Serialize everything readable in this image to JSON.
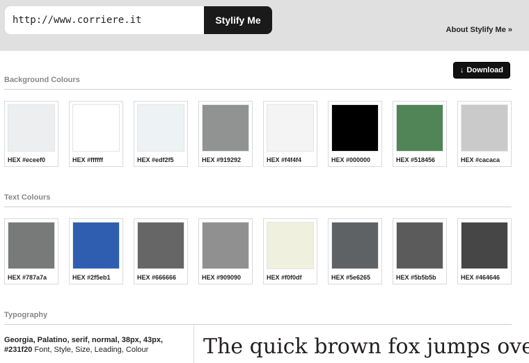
{
  "header": {
    "url_value": "http://www.corriere.it",
    "submit_label": "Stylify Me",
    "about_link": "About Stylify Me »"
  },
  "download_label": "Download",
  "background_colours": {
    "title": "Background Colours",
    "swatches": [
      {
        "hex": "#eceef0",
        "label": "HEX #eceef0"
      },
      {
        "hex": "#ffffff",
        "label": "HEX #ffffff"
      },
      {
        "hex": "#edf2f5",
        "label": "HEX #edf2f5"
      },
      {
        "hex": "#919292",
        "label": "HEX #919292"
      },
      {
        "hex": "#f4f4f4",
        "label": "HEX #f4f4f4"
      },
      {
        "hex": "#000000",
        "label": "HEX #000000"
      },
      {
        "hex": "#518456",
        "label": "HEX #518456"
      },
      {
        "hex": "#cacaca",
        "label": "HEX #cacaca"
      }
    ]
  },
  "text_colours": {
    "title": "Text Colours",
    "swatches": [
      {
        "hex": "#787a7a",
        "label": "HEX #787a7a"
      },
      {
        "hex": "#2f5eb1",
        "label": "HEX #2f5eb1"
      },
      {
        "hex": "#666666",
        "label": "HEX #666666"
      },
      {
        "hex": "#909090",
        "label": "HEX #909090"
      },
      {
        "hex": "#f0f0df",
        "label": "HEX #f0f0df"
      },
      {
        "hex": "#5e6265",
        "label": "HEX #5e6265"
      },
      {
        "hex": "#5b5b5b",
        "label": "HEX #5b5b5b"
      },
      {
        "hex": "#464646",
        "label": "HEX #464646"
      }
    ]
  },
  "typography": {
    "title": "Typography",
    "spec_bold": "Georgia, Palatino, serif, normal, 38px, 43px, #231f20",
    "spec_desc": " Font, Style, Size, Leading, Colour",
    "sample": "The quick brown fox jumps over the lazy dog"
  }
}
